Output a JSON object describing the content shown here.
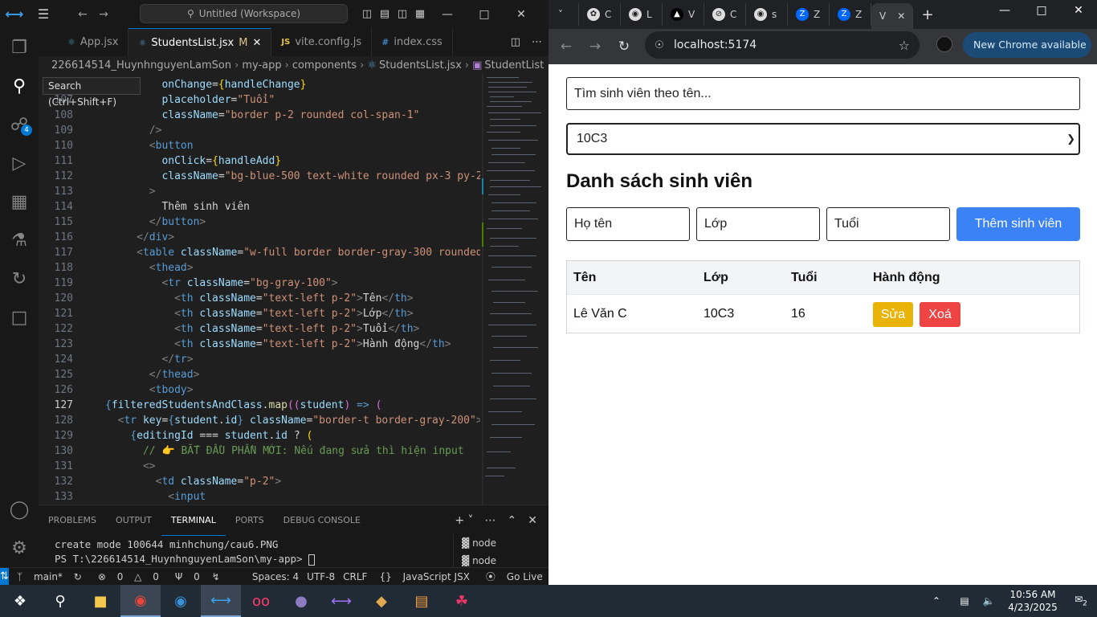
{
  "vscode": {
    "command_center": "Untitled (Workspace)",
    "tooltip": "Search (Ctrl+Shift+F)",
    "source_control_badge": "4",
    "tabs": [
      {
        "icon": "react-icon",
        "label": "App.jsx",
        "modified": ""
      },
      {
        "icon": "react-icon",
        "label": "StudentsList.jsx",
        "modified": "M"
      },
      {
        "icon": "js-icon",
        "label": "vite.config.js",
        "modified": ""
      },
      {
        "icon": "css-icon",
        "label": "index.css",
        "modified": ""
      }
    ],
    "breadcrumb": [
      "226614514_HuynhnguyenLamSon",
      "my-app",
      "components",
      "StudentsList.jsx",
      "StudentList"
    ],
    "code_lines": [
      {
        "n": "",
        "cur": false
      },
      {
        "n": "107",
        "cur": false
      },
      {
        "n": "108",
        "cur": false
      },
      {
        "n": "109",
        "cur": false
      },
      {
        "n": "110",
        "cur": false
      },
      {
        "n": "111",
        "cur": false
      },
      {
        "n": "112",
        "cur": false
      },
      {
        "n": "113",
        "cur": false
      },
      {
        "n": "114",
        "cur": false
      },
      {
        "n": "115",
        "cur": false
      },
      {
        "n": "116",
        "cur": false
      },
      {
        "n": "117",
        "cur": false
      },
      {
        "n": "118",
        "cur": false
      },
      {
        "n": "119",
        "cur": false
      },
      {
        "n": "120",
        "cur": false
      },
      {
        "n": "121",
        "cur": false
      },
      {
        "n": "122",
        "cur": false
      },
      {
        "n": "123",
        "cur": false
      },
      {
        "n": "124",
        "cur": false
      },
      {
        "n": "125",
        "cur": false
      },
      {
        "n": "126",
        "cur": false
      },
      {
        "n": "127",
        "cur": true
      },
      {
        "n": "128",
        "cur": false
      },
      {
        "n": "129",
        "cur": false
      },
      {
        "n": "130",
        "cur": false
      },
      {
        "n": "131",
        "cur": false
      },
      {
        "n": "132",
        "cur": false
      },
      {
        "n": "133",
        "cur": false
      }
    ],
    "panel_tabs": [
      "PROBLEMS",
      "OUTPUT",
      "TERMINAL",
      "PORTS",
      "DEBUG CONSOLE"
    ],
    "terminal_lines": [
      "create mode 100644 minhchung/cau6.PNG",
      "PS T:\\226614514_HuynhnguyenLamSon\\my-app> "
    ],
    "terminal_instances": [
      "node",
      "node"
    ],
    "status": {
      "branch": "main*",
      "errors": "0",
      "warnings": "0",
      "info": "0",
      "spaces": "Spaces: 4",
      "encoding": "UTF-8",
      "eol": "CRLF",
      "language": "JavaScript JSX",
      "golive": "Go Live"
    }
  },
  "chrome": {
    "tabs": [
      "C",
      "L",
      "V",
      "C",
      "s",
      "Z",
      "Z",
      "V"
    ],
    "url": "localhost:5174",
    "new_chrome": "New Chrome available"
  },
  "app": {
    "search_placeholder": "Tìm sinh viên theo tên...",
    "class_selected": "10C3",
    "title": "Danh sách sinh viên",
    "form": {
      "name_placeholder": "Họ tên",
      "class_placeholder": "Lớp",
      "age_placeholder": "Tuổi",
      "add_label": "Thêm sinh viên"
    },
    "columns": [
      "Tên",
      "Lớp",
      "Tuổi",
      "Hành động"
    ],
    "rows": [
      {
        "name": "Lê Văn C",
        "class": "10C3",
        "age": "16"
      }
    ],
    "edit_label": "Sửa",
    "delete_label": "Xoá"
  },
  "taskbar": {
    "time": "10:56 AM",
    "date": "4/23/2025",
    "notifications": "2"
  }
}
